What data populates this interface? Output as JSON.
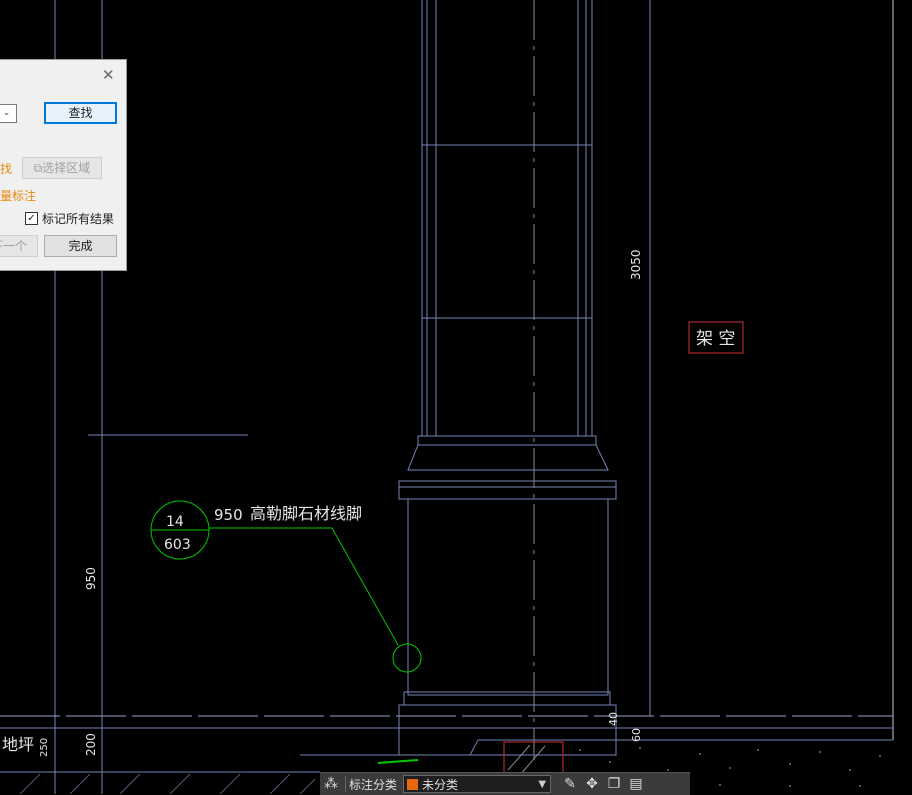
{
  "dialog": {
    "find_button": "查找",
    "select_area_prefix": "找",
    "select_area_button": "选择区域",
    "batch_label": "量标注",
    "mark_all_label": "标记所有结果",
    "mark_all_checked": true,
    "next_button": "下一个",
    "done_button": "完成"
  },
  "drawing": {
    "dim_3050": "3050",
    "dim_950": "950",
    "dim_200": "200",
    "dim_40": "40",
    "dim_60": "60",
    "tag_top": "14",
    "tag_bottom": "603",
    "note_num": "950",
    "note_text": "高勒脚石材线脚",
    "overhead_label": "架 空",
    "floor_label": "地坪",
    "floor_dim": "250"
  },
  "toolbar": {
    "label": "标注分类",
    "category_value": "未分类",
    "category_color": "#e8660c"
  },
  "colors": {
    "background": "#000000",
    "green": "#00c800",
    "blue_lines": "#5a6ea8",
    "red": "#d03030"
  }
}
